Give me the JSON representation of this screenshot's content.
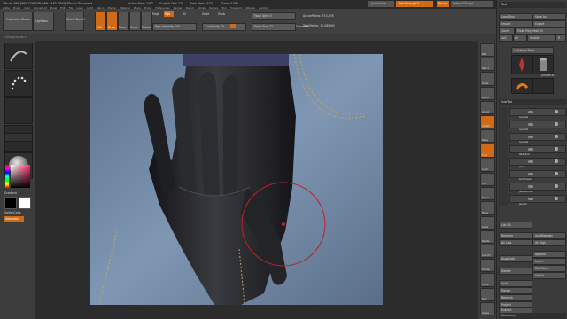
{
  "menubar": {
    "title": "ZBrush 4R6 [WKS12Y802PHARN-3483-DIM3]   ZBrush Document",
    "mem": "Active Mem 2457",
    "scratch": "Scratch Disk 270",
    "free": "Free Mem 7470",
    "timer": "Timer 0.081",
    "menus": [
      "Alpha",
      "Brush",
      "Color",
      "Document",
      "Draw",
      "Edit",
      "File",
      "Layer",
      "Light",
      "Macro",
      "Marker",
      "Material",
      "Movie",
      "Picker",
      "Preferences",
      "Render",
      "Stencil",
      "Stroke",
      "Texture",
      "Tool",
      "Transform",
      "Zplugin",
      "Zscript"
    ],
    "quicksave": "QuickSave",
    "seethrough": "See-through 0",
    "menus_btn": "Menus",
    "default_zscript": "DefaultZScript"
  },
  "toolbar": {
    "projection_master": "Projection Master",
    "lightbox": "LightBox",
    "quick_sketch": "Quick Sketch",
    "edit": "Edit",
    "draw": "Draw",
    "move": "Move",
    "scale": "Scale",
    "rotate": "Rotate",
    "mrgb": "Mrgb",
    "rgb": "Rgb",
    "m": "M",
    "rgb_intensity": "Rgb Intensity 100",
    "zadd": "Zadd",
    "zsub": "Zsub",
    "z_intensity": "Z Intensity 25",
    "focal_shift": "Focal Shift 0",
    "draw_size": "Draw Size 22",
    "dynamic": "Dynamic",
    "active_points": "ActivePoints: 374,476",
    "total_points": "TotalPoints: 12,089 Mil"
  },
  "status": {
    "file": "S.Kiln.pt.ay.bp.r4"
  },
  "leftshelf": {
    "gradient": "Gradient",
    "switch_color": "SwitchColor",
    "alternate": "Alternate"
  },
  "rightshelf": {
    "items": [
      "BPR",
      "SPix 3",
      "Scroll",
      "Zoom",
      "Actual",
      "AAHalf",
      "Persp",
      "Floor",
      "Local",
      "XYZ",
      "Frame",
      "Move",
      "Scale",
      "Rotate",
      "Line Fill",
      "Transp",
      "Ghost",
      "Solo",
      "Xpose"
    ]
  },
  "tray": {
    "tool_header": "Tool",
    "load_tool": "Load Tool",
    "save_as": "Save As",
    "import": "Import",
    "export": "Export",
    "clone": "Clone",
    "make_polymesh": "Make PolyMesh3D",
    "goz": "GoZ",
    "all": "All",
    "visible": "Visible",
    "r": "R",
    "lightbox_tools": "Lightbox▸Tools",
    "current_tool": "Cylinder3D",
    "tool_thumbs": [
      "Cylinder3D",
      "SimpleBrush",
      "Cylinder3D"
    ],
    "subtool_header": "SubTool",
    "subtools": [
      "Gumie4",
      "Gumie5",
      "Gumie6",
      "fbt4_000",
      "glove",
      "bodymesh",
      "Jeanspocket",
      "Jeans2"
    ],
    "list_all": "List All",
    "rename": "Rename",
    "auto_reorder": "AutoReorder",
    "all_low": "All Low",
    "all_high": "All High",
    "duplicate": "Duplicate",
    "append": "Append",
    "insert": "Insert",
    "del_other": "Del Other",
    "delete": "Delete",
    "del_all": "Del All",
    "split": "Split",
    "merge": "Merge",
    "remesh": "Remesh",
    "project": "Project",
    "extract": "Extract",
    "geometry": "Geometry"
  },
  "colors": {
    "accent": "#d16a17",
    "brush_circle": "#c0202a",
    "denim": "#6f86a0",
    "glove": "#1e1e22"
  }
}
